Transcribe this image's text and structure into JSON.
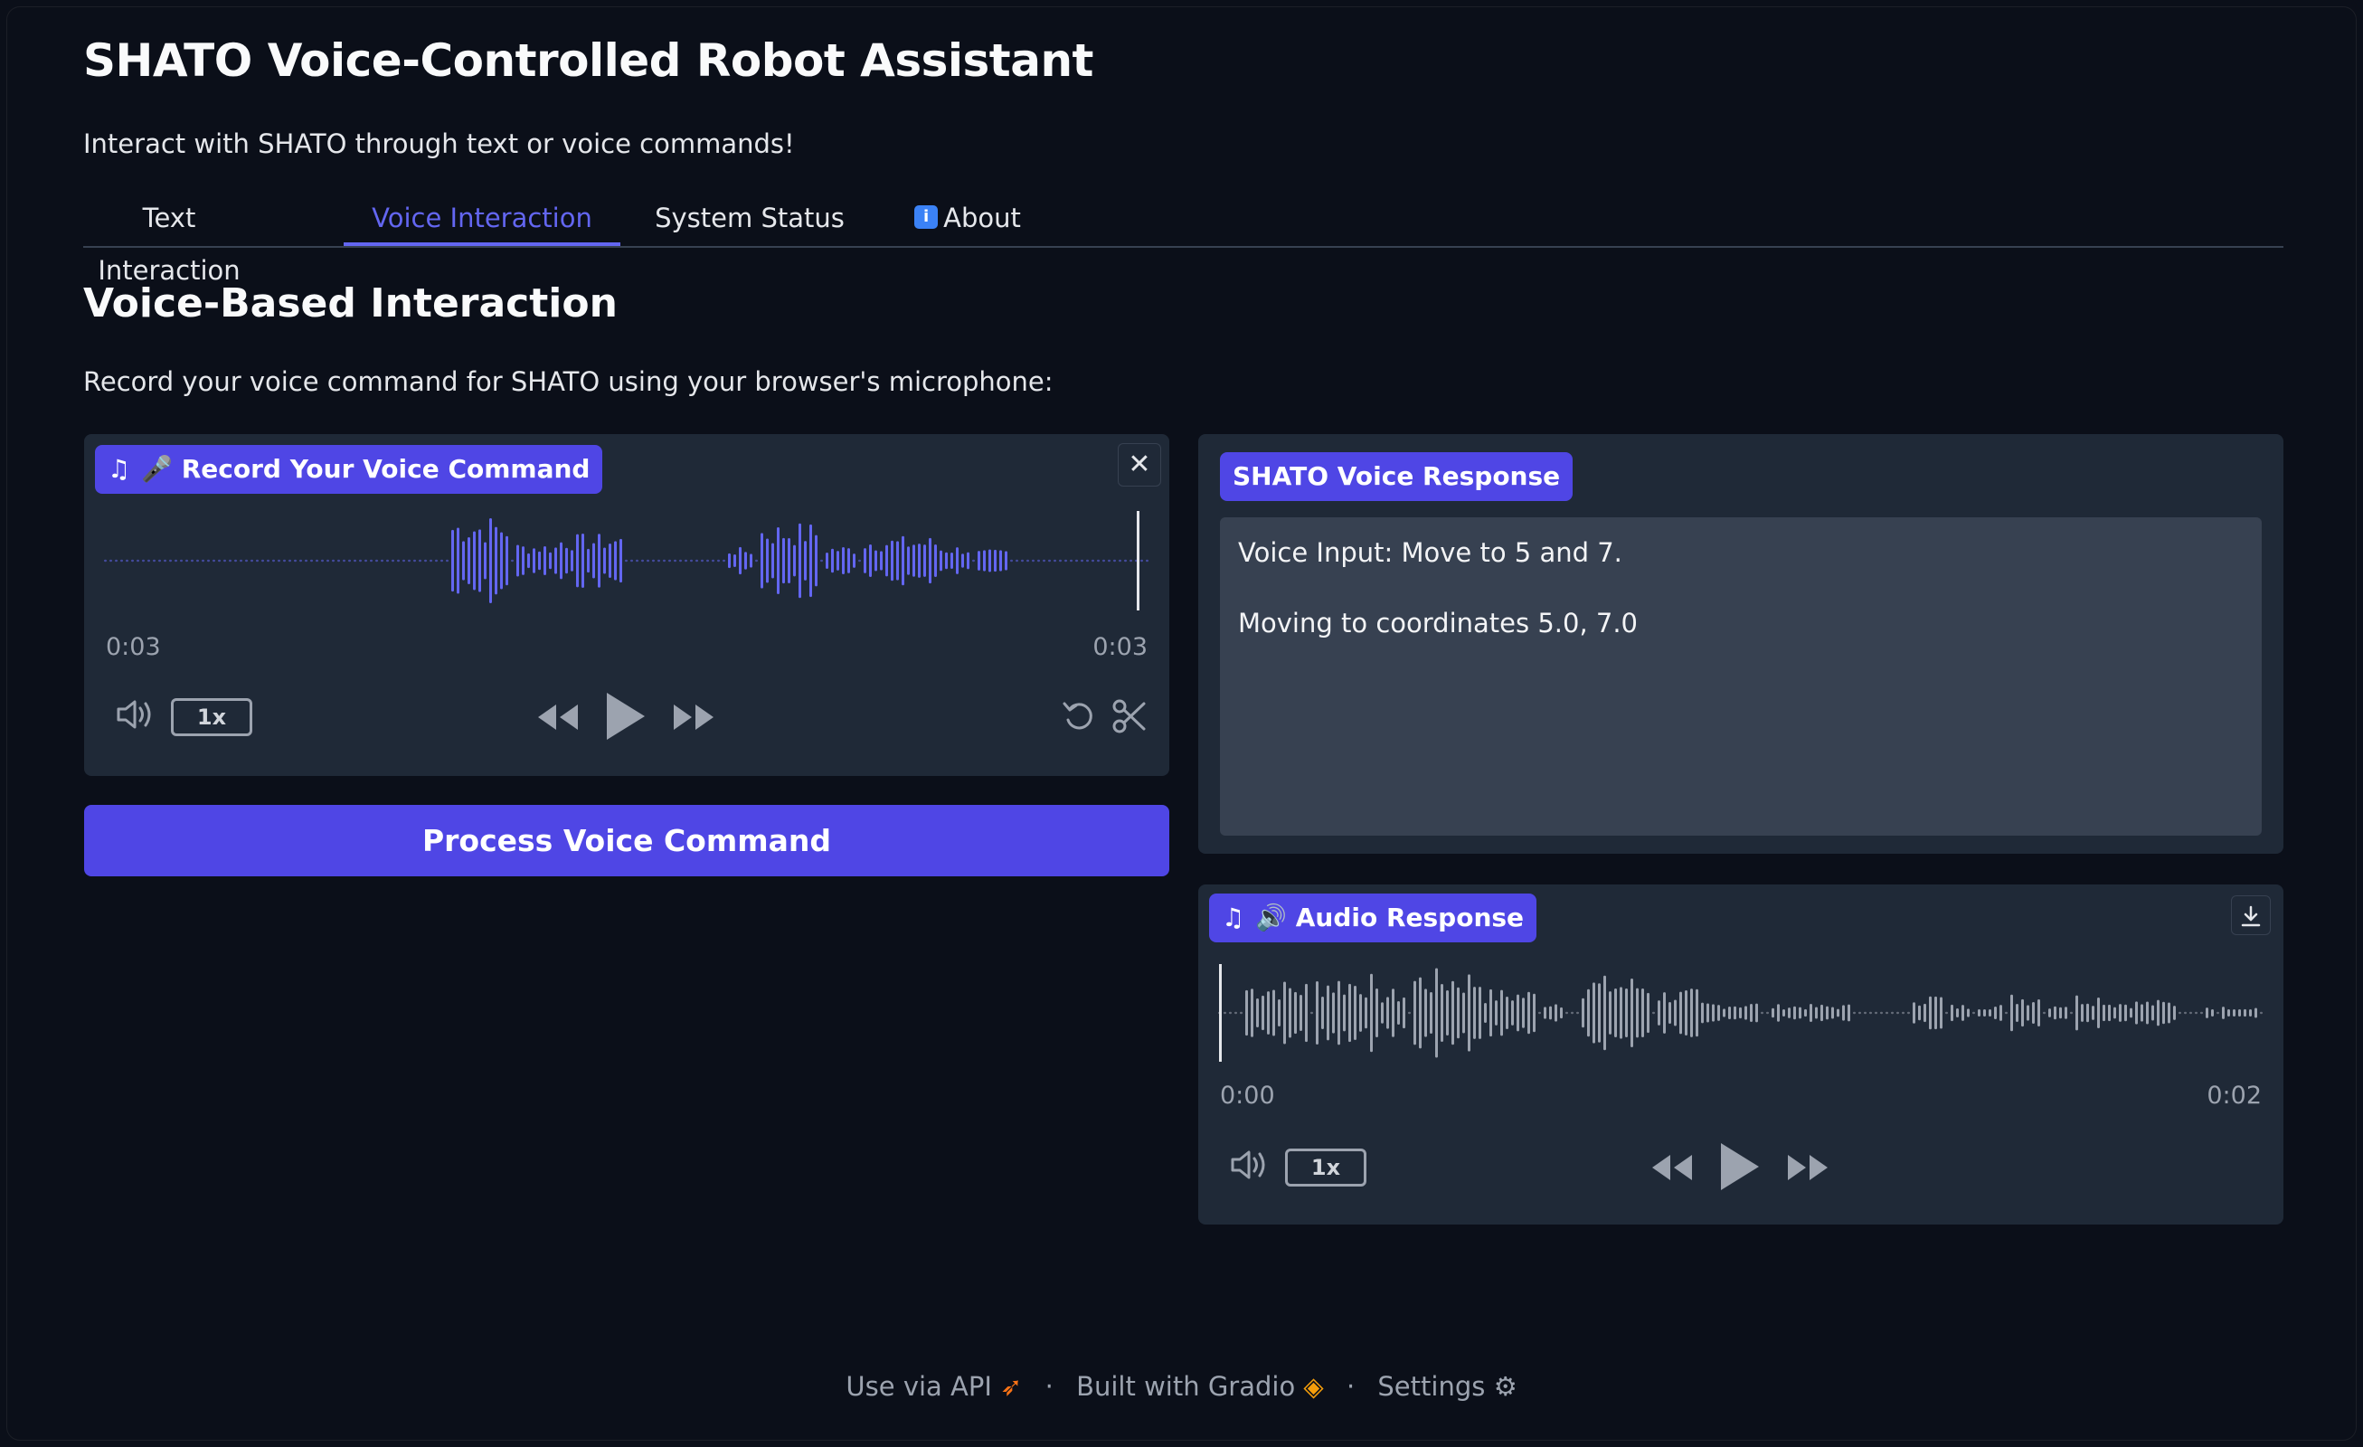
{
  "app": {
    "title": "SHATO Voice-Controlled Robot Assistant",
    "subtitle": "Interact with SHATO through text or voice commands!"
  },
  "tabs": [
    {
      "label": "Text Interaction",
      "active": false
    },
    {
      "label": "Voice Interaction",
      "active": true
    },
    {
      "label": "System Status",
      "active": false
    },
    {
      "label": "About",
      "active": false,
      "icon": "info-icon"
    }
  ],
  "section": {
    "title": "Voice-Based Interaction",
    "description": "Record your voice command for SHATO using your browser's microphone:"
  },
  "record_panel": {
    "label": "🎤 Record Your Voice Command",
    "current_time": "0:03",
    "duration": "0:03",
    "playback_rate": "1x",
    "waveform_color": "#6366f1"
  },
  "process_button": {
    "label": "Process Voice Command"
  },
  "response_panel": {
    "label": "SHATO Voice Response",
    "lines": [
      "Voice Input: Move to 5 and 7.",
      "Moving to coordinates 5.0, 7.0"
    ]
  },
  "audio_response": {
    "label": "🔊 Audio Response",
    "current_time": "0:00",
    "duration": "0:02",
    "playback_rate": "1x",
    "waveform_color": "#9ca3af"
  },
  "footer": {
    "api_link": "Use via API",
    "gradio_link": "Built with Gradio",
    "settings_link": "Settings",
    "separator": "·"
  },
  "colors": {
    "background": "#0b0f19",
    "panel": "#1f2937",
    "accent": "#4f46e5",
    "accent_text": "#6366f1"
  }
}
